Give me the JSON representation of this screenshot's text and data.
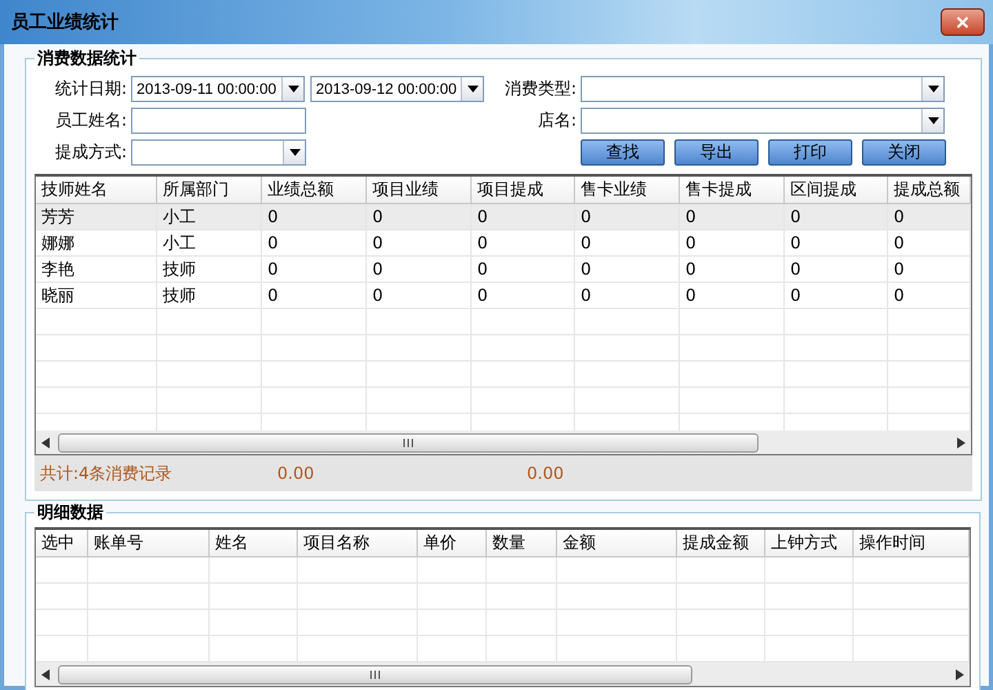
{
  "window": {
    "title": "员工业绩统计",
    "close_label": "✕"
  },
  "query_panel": {
    "title": "消费数据统计",
    "date_label": "统计日期:",
    "date_from": "2013-09-11 00:00:00",
    "date_to": "2013-09-12 00:00:00",
    "type_label": "消费类型:",
    "name_label": "员工姓名:",
    "store_label": "店名:",
    "commission_label": "提成方式:",
    "buttons": [
      "查找",
      "导出",
      "打印",
      "关闭"
    ]
  },
  "summary_table": {
    "columns": [
      "技师姓名",
      "所属部门",
      "业绩总额",
      "项目业绩",
      "项目提成",
      "售卡业绩",
      "售卡提成",
      "区间提成",
      "提成总额"
    ],
    "rows": [
      {
        "selected": true,
        "cells": [
          "芳芳",
          "小工",
          "0",
          "0",
          "0",
          "0",
          "0",
          "0",
          "0"
        ]
      },
      {
        "selected": false,
        "cells": [
          "娜娜",
          "小工",
          "0",
          "0",
          "0",
          "0",
          "0",
          "0",
          "0"
        ]
      },
      {
        "selected": false,
        "cells": [
          "李艳",
          "技师",
          "0",
          "0",
          "0",
          "0",
          "0",
          "0",
          "0"
        ]
      },
      {
        "selected": false,
        "cells": [
          "晓丽",
          "技师",
          "0",
          "0",
          "0",
          "0",
          "0",
          "0",
          "0"
        ]
      }
    ]
  },
  "totals": {
    "label": "共计:4条消费记录",
    "value_1": "0.00",
    "value_2": "0.00"
  },
  "detail_panel": {
    "title": "明细数据",
    "columns": [
      "选中",
      "账单号",
      "姓名",
      "项目名称",
      "单价",
      "数量",
      "金额",
      "提成金额",
      "上钟方式",
      "操作时间"
    ]
  }
}
